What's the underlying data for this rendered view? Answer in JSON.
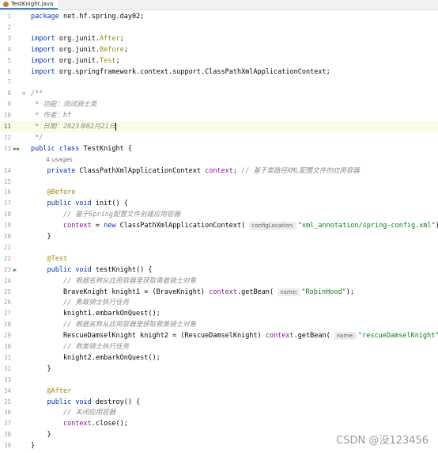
{
  "tab": {
    "title": "TestKnight.java",
    "icon": "java-class-icon"
  },
  "watermark": "CSDN @没123456",
  "usages": "4 usages",
  "lines": [
    {
      "n": "1",
      "html": "<span class='kw'>package</span> net.hf.spring.day02;"
    },
    {
      "n": "2",
      "html": ""
    },
    {
      "n": "3",
      "html": "<span class='kw'>import</span> org.junit.<span class='ann'>After</span>;"
    },
    {
      "n": "4",
      "html": "<span class='kw'>import</span> org.junit.<span class='ann'>Before</span>;"
    },
    {
      "n": "5",
      "html": "<span class='kw'>import</span> org.junit.<span class='ann'>Test</span>;"
    },
    {
      "n": "6",
      "html": "<span class='kw'>import</span> org.springframework.context.support.ClassPathXmlApplicationContext;"
    },
    {
      "n": "7",
      "html": ""
    },
    {
      "n": "8",
      "html": "<span class='cmt'>/**</span>"
    },
    {
      "n": "9",
      "html": "<span class='cmt'> * 功能：测试骑士类</span>"
    },
    {
      "n": "10",
      "html": "<span class='cmt'> * 作者：hf</span>"
    },
    {
      "n": "11",
      "html": "<span class='cmt'> * 日期：2023年02月21日</span>"
    },
    {
      "n": "12",
      "html": "<span class='cmt'> */</span>"
    },
    {
      "n": "13",
      "html": "<span class='kw'>public class</span> TestKnight {"
    },
    {
      "n": "",
      "html": ""
    },
    {
      "n": "14",
      "html": "    <span class='kw'>private</span> ClassPathXmlApplicationContext <span class='fld'>context</span>; <span class='cmt'>// 基于类路径XML配置文件的应用容器</span>"
    },
    {
      "n": "15",
      "html": ""
    },
    {
      "n": "16",
      "html": "    <span class='ann'>@Before</span>"
    },
    {
      "n": "17",
      "html": "    <span class='kw'>public void</span> init() {"
    },
    {
      "n": "18",
      "html": "        <span class='cmt'>// 基于Spring配置文件创建应用容器</span>"
    },
    {
      "n": "19",
      "html": "        <span class='fld'>context</span> = <span class='kw'>new</span> ClassPathXmlApplicationContext( <span class='hint'>configLocation:</span><span class='str'>\"xml_annotation/spring-config.xml\"</span>);"
    },
    {
      "n": "20",
      "html": "    }"
    },
    {
      "n": "21",
      "html": ""
    },
    {
      "n": "22",
      "html": "    <span class='ann'>@Test</span>"
    },
    {
      "n": "23",
      "html": "    <span class='kw'>public void</span> testKnight() {"
    },
    {
      "n": "24",
      "html": "        <span class='cmt'>// 根据名称从应用容器里获取勇敢骑士对象</span>"
    },
    {
      "n": "25",
      "html": "        BraveKnight knight1 = (BraveKnight) <span class='fld'>context</span>.getBean( <span class='hint'>name:</span><span class='str'>\"RobinHood\"</span>);"
    },
    {
      "n": "26",
      "html": "        <span class='cmt'>// 勇敢骑士执行任务</span>"
    },
    {
      "n": "27",
      "html": "        knight1.embarkOnQuest();"
    },
    {
      "n": "28",
      "html": "        <span class='cmt'>// 根据名称从应用容器里获取救美骑士对象</span>"
    },
    {
      "n": "29",
      "html": "        RescueDamselKnight knight2 = (RescueDamselKnight) <span class='fld'>context</span>.getBean( <span class='hint'>name:</span><span class='str'>\"rescueDamselKnight\"</span>);"
    },
    {
      "n": "30",
      "html": "        <span class='cmt'>// 救美骑士执行任务</span>"
    },
    {
      "n": "31",
      "html": "        knight2.embarkOnQuest();"
    },
    {
      "n": "32",
      "html": "    }"
    },
    {
      "n": "33",
      "html": ""
    },
    {
      "n": "34",
      "html": "    <span class='ann'>@After</span>"
    },
    {
      "n": "35",
      "html": "    <span class='kw'>public void</span> destroy() {"
    },
    {
      "n": "36",
      "html": "        <span class='cmt'>// 关闭应用容器</span>"
    },
    {
      "n": "37",
      "html": "        <span class='fld'>context</span>.close();"
    },
    {
      "n": "38",
      "html": "    }"
    },
    {
      "n": "39",
      "html": "}"
    }
  ],
  "markers": {
    "fold_line": "8",
    "run_class_line": "13",
    "run_test_line": "23",
    "current_line": "11"
  }
}
